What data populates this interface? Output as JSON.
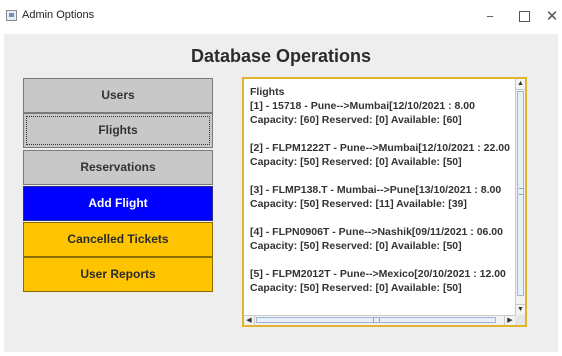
{
  "window": {
    "title": "Admin Options",
    "controls": {
      "minimize": "−",
      "close": "✕"
    }
  },
  "page": {
    "header": "Database Operations"
  },
  "menu": {
    "users": "Users",
    "flights": "Flights",
    "reservations": "Reservations",
    "add_flight": "Add Flight",
    "cancelled_tickets": "Cancelled Tickets",
    "user_reports": "User Reports"
  },
  "colors": {
    "gray_button": "#c8c8c8",
    "add_flight_button": "#0000ff",
    "yellow_button": "#ffc400",
    "panel_border": "#e0b52d"
  },
  "output": {
    "heading": "Flights",
    "flights": [
      {
        "line1": "[1] - 15718 - Pune-->Mumbai[12/10/2021 : 8.00",
        "line2": "Capacity: [60] Reserved: [0] Available: [60]"
      },
      {
        "line1": "[2] - FLPM1222T - Pune-->Mumbai[12/10/2021 : 22.00",
        "line2": "Capacity: [50] Reserved: [0] Available: [50]"
      },
      {
        "line1": "[3] - FLMP138.T - Mumbai-->Pune[13/10/2021 : 8.00",
        "line2": "Capacity: [50] Reserved: [11] Available: [39]"
      },
      {
        "line1": "[4] - FLPN0906T - Pune-->Nashik[09/11/2021 : 06.00",
        "line2": "Capacity: [50] Reserved: [0] Available: [50]"
      },
      {
        "line1": "[5] - FLPM2012T - Pune-->Mexico[20/10/2021 : 12.00",
        "line2": "Capacity: [50] Reserved: [0] Available: [50]"
      }
    ]
  },
  "icons": {
    "app": "app-window-icon",
    "scroll_up": "▲",
    "scroll_down": "▼",
    "scroll_left": "◀",
    "scroll_right": "▶"
  }
}
